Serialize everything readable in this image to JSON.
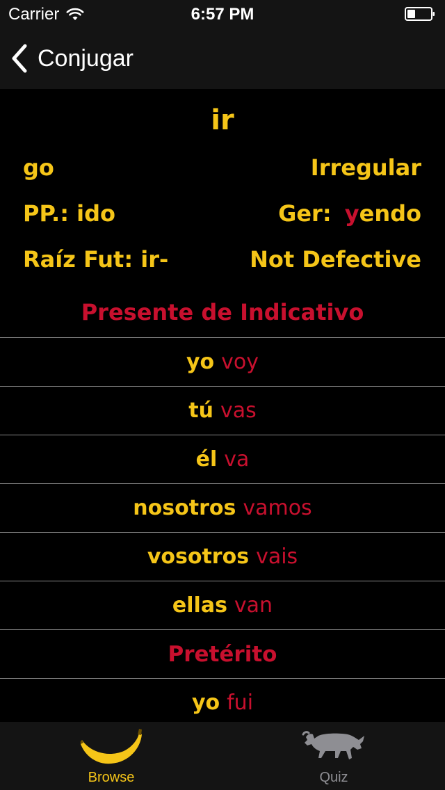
{
  "status_bar": {
    "carrier": "Carrier",
    "time": "6:57 PM"
  },
  "nav": {
    "back_label": "Conjugar"
  },
  "verb": {
    "infinitive": "ir",
    "translation": "go",
    "type": "Irregular",
    "pp_label": "PP.:",
    "pp_value": "ido",
    "ger_label": "Ger:",
    "ger_highlight": "y",
    "ger_rest": "endo",
    "fut_root": "Raíz Fut: ir-",
    "defective": "Not Defective"
  },
  "sections": [
    {
      "title": "Presente de Indicativo",
      "rows": [
        {
          "pronoun": "yo",
          "form": "voy"
        },
        {
          "pronoun": "tú",
          "form": "vas"
        },
        {
          "pronoun": "él",
          "form": "va"
        },
        {
          "pronoun": "nosotros",
          "form": "vamos"
        },
        {
          "pronoun": "vosotros",
          "form": "vais"
        },
        {
          "pronoun": "ellas",
          "form": "van"
        }
      ]
    },
    {
      "title": "Pretérito",
      "rows": [
        {
          "pronoun": "yo",
          "form": "fui"
        }
      ]
    }
  ],
  "tabs": [
    {
      "label": "Browse",
      "icon": "banana-icon",
      "color": "#f5c518",
      "active": true
    },
    {
      "label": "Quiz",
      "icon": "bull-icon",
      "color": "#8e8e93",
      "active": false
    }
  ],
  "colors": {
    "accent_yellow": "#f5c518",
    "accent_red": "#c8102e",
    "bar_bg": "#141414"
  }
}
